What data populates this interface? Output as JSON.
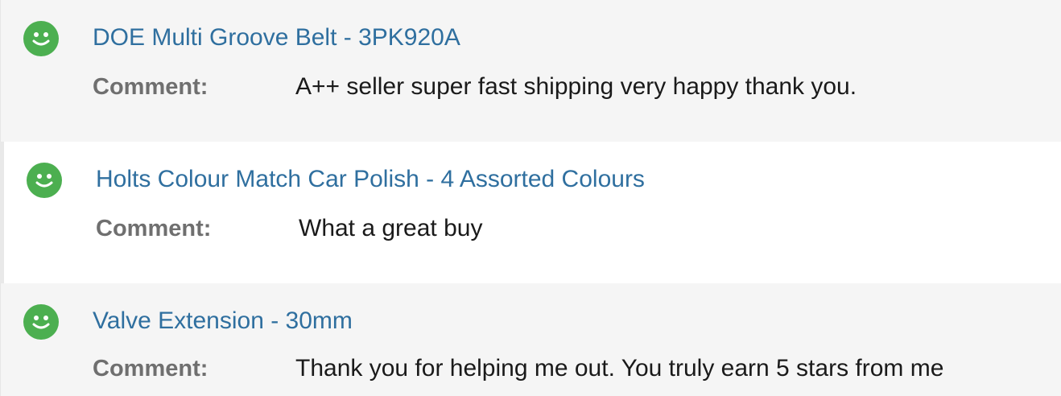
{
  "feedback": {
    "items": [
      {
        "rating_icon": "positive-smiley-icon",
        "title": "DOE Multi Groove Belt - 3PK920A",
        "comment_label": "Comment:",
        "comment": "A++ seller super fast shipping very happy thank you."
      },
      {
        "rating_icon": "positive-smiley-icon",
        "title": "Holts Colour Match Car Polish - 4 Assorted Colours",
        "comment_label": "Comment:",
        "comment": "What a great buy"
      },
      {
        "rating_icon": "positive-smiley-icon",
        "title": "Valve Extension - 30mm",
        "comment_label": "Comment:",
        "comment": "Thank you for helping me out. You truly earn 5 stars from me"
      }
    ]
  },
  "colors": {
    "positive_icon": "#4caf50",
    "link": "#2f6f9f",
    "label": "#6f6f6f",
    "text": "#1a1a1a",
    "row_alt_background": "#f5f5f5"
  }
}
